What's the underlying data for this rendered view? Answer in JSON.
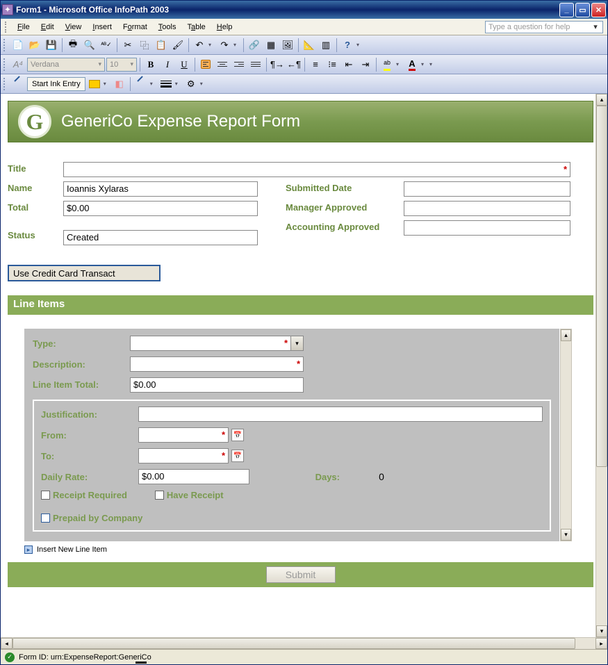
{
  "window": {
    "title": "Form1 - Microsoft Office InfoPath 2003"
  },
  "menubar": {
    "file": "File",
    "edit": "Edit",
    "view": "View",
    "insert": "Insert",
    "format": "Format",
    "tools": "Tools",
    "table": "Table",
    "help": "Help",
    "helpbox_placeholder": "Type a question for help"
  },
  "format_toolbar": {
    "font_name": "Verdana",
    "font_size": "10"
  },
  "ink_toolbar": {
    "start_ink": "Start Ink Entry"
  },
  "form": {
    "banner_logo_letter": "G",
    "banner_title": "GeneriCo Expense Report Form",
    "labels": {
      "title": "Title",
      "name": "Name",
      "total": "Total",
      "status": "Status",
      "submitted": "Submitted Date",
      "manager": "Manager Approved",
      "accounting": "Accounting Approved"
    },
    "values": {
      "title": "",
      "name": "Ioannis Xylaras",
      "total": "$0.00",
      "status": "Created",
      "submitted": "",
      "manager": "",
      "accounting": ""
    },
    "cc_button": "Use Credit Card Transact",
    "line_items_header": "Line Items",
    "li": {
      "labels": {
        "type": "Type:",
        "description": "Description:",
        "li_total": "Line Item Total:",
        "justification": "Justification:",
        "from": "From:",
        "to": "To:",
        "daily_rate": "Daily Rate:",
        "days": "Days:",
        "receipt_required": "Receipt Required",
        "have_receipt": "Have Receipt",
        "prepaid": "Prepaid by Company"
      },
      "values": {
        "type": "",
        "description": "",
        "li_total": "$0.00",
        "justification": "",
        "from": "",
        "to": "",
        "daily_rate": "$0.00",
        "days": "0"
      },
      "checks": {
        "receipt_required": false,
        "have_receipt": false,
        "prepaid": false
      }
    },
    "insert_label": "Insert New Line Item",
    "submit_label": "Submit"
  },
  "statusbar": {
    "text": "Form ID: urn:ExpenseReport:GeneriCo"
  }
}
